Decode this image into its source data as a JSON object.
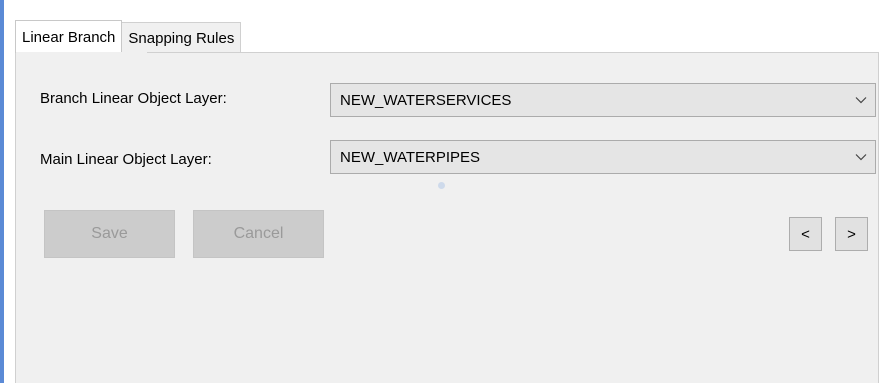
{
  "tabs": [
    {
      "label": "Linear Branch",
      "active": true
    },
    {
      "label": "Snapping Rules",
      "active": false
    }
  ],
  "form": {
    "branch_layer": {
      "label": "Branch Linear Object Layer:",
      "value": "NEW_WATERSERVICES"
    },
    "main_layer": {
      "label": "Main Linear Object Layer:",
      "value": "NEW_WATERPIPES"
    }
  },
  "buttons": {
    "save_label": "Save",
    "cancel_label": "Cancel",
    "prev_label": "<",
    "next_label": ">"
  },
  "colors": {
    "panel_background": "#f0f0f0",
    "disabled_button": "#cccccc",
    "disabled_text": "#9a9a9a",
    "combo_background": "#e5e5e5",
    "window_accent": "#5b8ad6"
  },
  "icons": {
    "dropdown": "chevron-down-icon"
  }
}
